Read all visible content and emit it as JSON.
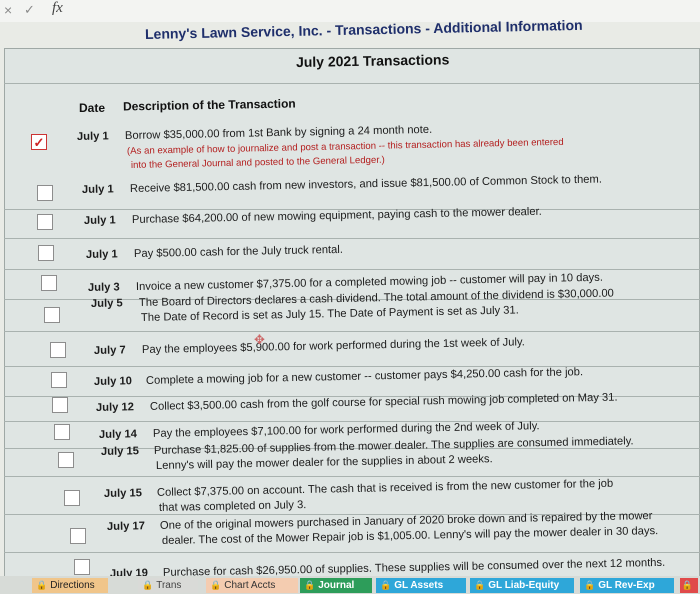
{
  "formula_bar": {
    "cancel_icon": "×",
    "enter_icon": "✓",
    "function_icon": "fx"
  },
  "header": {
    "title": "Lenny's Lawn Service, Inc.  -  Transactions  -  Additional Information",
    "subtitle": "July 2021 Transactions"
  },
  "columns": {
    "date": "Date",
    "description": "Description of the Transaction"
  },
  "example": {
    "date": "July 1",
    "description": "Borrow $35,000.00 from 1st Bank by signing a 24 month note.",
    "note_line1": "(As an example of how to journalize and post a transaction -- this transaction has already been entered",
    "note_line2": "into the General Journal and posted to the General Ledger.)",
    "checked_mark": "✓"
  },
  "transactions": [
    {
      "date": "July 1",
      "desc": "Receive $81,500.00 cash from new investors, and issue $81,500.00 of Common Stock to them."
    },
    {
      "date": "July 1",
      "desc": "Purchase $64,200.00 of new mowing equipment, paying cash to the mower dealer."
    },
    {
      "date": "July 1",
      "desc": "Pay $500.00 cash for the July truck rental."
    },
    {
      "date": "July 3",
      "desc": "Invoice a new customer $7,375.00 for a completed mowing job -- customer will pay in 10 days."
    },
    {
      "date": "July 5",
      "desc": "The Board of Directors declares a cash dividend.  The total amount of the dividend is $30,000.00",
      "desc2": "The Date of Record is set as July 15.  The Date of Payment is set as July 31."
    },
    {
      "date": "July 7",
      "desc": "Pay the employees $5,900.00 for work performed during the 1st week of July."
    },
    {
      "date": "July 10",
      "desc": "Complete a mowing job for a new customer -- customer pays $4,250.00 cash for the job."
    },
    {
      "date": "July 12",
      "desc": "Collect $3,500.00 cash from the golf course for special rush mowing job completed on May 31."
    },
    {
      "date": "July 14",
      "desc": "Pay the employees $7,100.00 for work performed during the 2nd week of July."
    },
    {
      "date": "July 15",
      "desc": "Purchase $1,825.00 of supplies from the mower dealer.  The supplies are consumed immediately.",
      "desc2": "Lenny's will pay the mower dealer for the supplies in about 2 weeks."
    },
    {
      "date": "July 15",
      "desc": "Collect $7,375.00 on account.  The cash that is received is from the new customer for the job",
      "desc2": "that was completed on July 3."
    },
    {
      "date": "July 17",
      "desc": "One of the original mowers purchased in January of 2020 broke down and is repaired by the mower",
      "desc2": "dealer.  The cost of the Mower Repair job is $1,005.00.  Lenny's will pay the mower dealer in 30 days."
    },
    {
      "date": "July 19",
      "desc": "Purchase for cash $26,950.00 of supplies.  These supplies will be consumed over the next 12 months."
    }
  ],
  "tabs": [
    "Directions",
    "Trans",
    "Chart Accts",
    "Journal",
    "GL Assets",
    "GL Liab-Equity",
    "GL Rev-Exp"
  ],
  "icons": {
    "lock": "🔒",
    "cursor": "✥"
  }
}
